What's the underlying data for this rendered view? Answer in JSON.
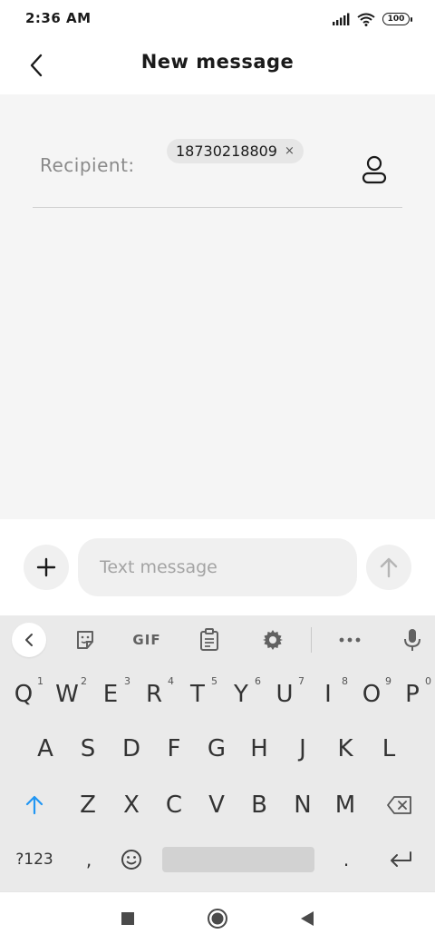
{
  "status_bar": {
    "time": "2:36 AM",
    "battery": "100"
  },
  "header": {
    "title": "New message"
  },
  "recipient": {
    "label": "Recipient:",
    "chips": [
      {
        "number": "18730218809",
        "close": "×"
      }
    ]
  },
  "compose": {
    "placeholder": "Text message"
  },
  "keyboard": {
    "toolbar": {
      "gif_label": "GIF"
    },
    "row1": [
      {
        "label": "Q",
        "hint": "1"
      },
      {
        "label": "W",
        "hint": "2"
      },
      {
        "label": "E",
        "hint": "3"
      },
      {
        "label": "R",
        "hint": "4"
      },
      {
        "label": "T",
        "hint": "5"
      },
      {
        "label": "Y",
        "hint": "6"
      },
      {
        "label": "U",
        "hint": "7"
      },
      {
        "label": "I",
        "hint": "8"
      },
      {
        "label": "O",
        "hint": "9"
      },
      {
        "label": "P",
        "hint": "0"
      }
    ],
    "row2": [
      "A",
      "S",
      "D",
      "F",
      "G",
      "H",
      "J",
      "K",
      "L"
    ],
    "row3": [
      "Z",
      "X",
      "C",
      "V",
      "B",
      "N",
      "M"
    ],
    "row4": {
      "symbols": "?123",
      "comma": ",",
      "period": "."
    }
  },
  "colors": {
    "accent": "#2196f3",
    "background": "#f5f5f5",
    "keyboard": "#eaeaea"
  }
}
